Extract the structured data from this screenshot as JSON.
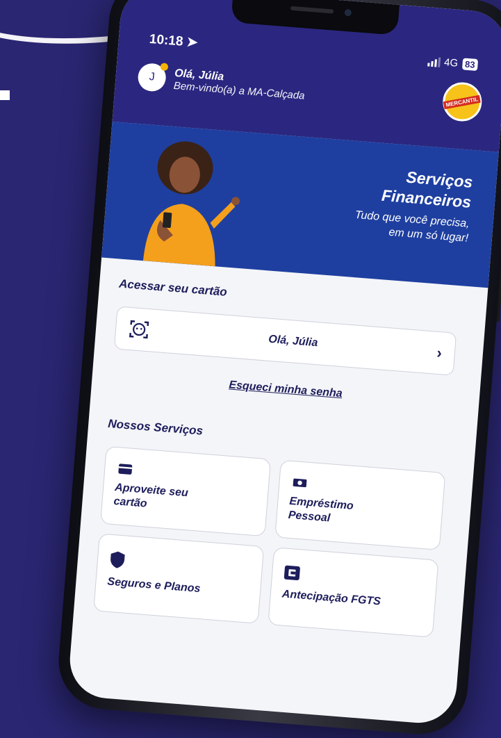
{
  "status_bar": {
    "time": "10:18",
    "network": "4G",
    "battery": "83"
  },
  "header": {
    "avatar_initial": "J",
    "greeting": "Olá, Júlia",
    "welcome": "Bem-vindo(a) a MA-Calçada",
    "logo_text": "MERCANTIL"
  },
  "banner": {
    "title_line1": "Serviços",
    "title_line2": "Financeiros",
    "tagline_line1": "Tudo que você precisa,",
    "tagline_line2": "em um só lugar!"
  },
  "access": {
    "section_title": "Acessar seu cartão",
    "card_label": "Olá, Júlia",
    "forgot_link": "Esqueci minha senha"
  },
  "services": {
    "section_title": "Nossos Serviços",
    "items": [
      {
        "line1": "Aproveite seu",
        "line2": "cartão",
        "icon": "card-icon"
      },
      {
        "line1": "Empréstimo",
        "line2": "Pessoal",
        "icon": "money-icon"
      },
      {
        "line1": "Seguros e Planos",
        "line2": "",
        "icon": "shield-icon"
      },
      {
        "line1": "Antecipação FGTS",
        "line2": "",
        "icon": "wallet-icon"
      }
    ]
  },
  "colors": {
    "primary": "#2b2780",
    "banner": "#1e3fa0",
    "accent": "#f7b500",
    "text": "#1d1d5c"
  }
}
